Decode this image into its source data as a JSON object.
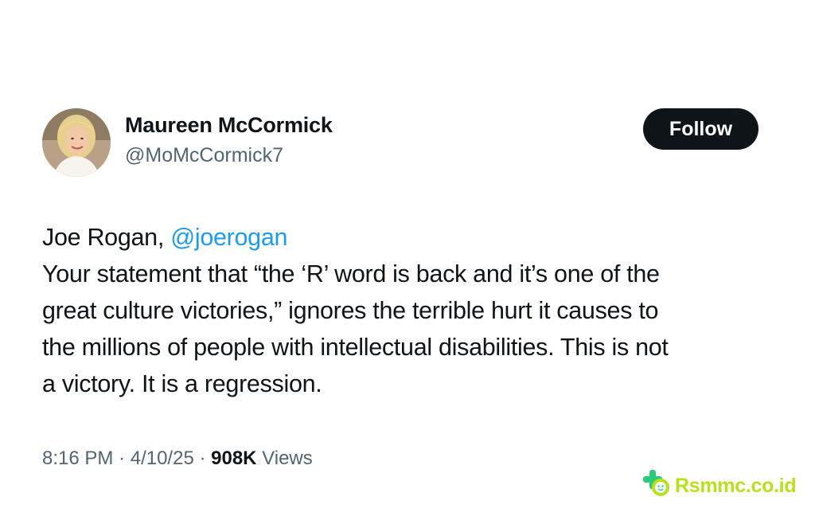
{
  "author": {
    "display_name": "Maureen McCormick",
    "handle": "@MoMcCormick7"
  },
  "follow_button": {
    "label": "Follow"
  },
  "tweet": {
    "line1_prefix": "Joe Rogan, ",
    "mention": "@joerogan",
    "line2": "Your statement that “the ‘R’ word is back and it’s one of the",
    "line3": "great culture victories,” ignores the terrible hurt it causes to",
    "line4": "the millions of people with intellectual disabilities. This is not",
    "line5": "a victory. It is a regression."
  },
  "meta": {
    "time": "8:16 PM",
    "separator": " · ",
    "date": "4/10/25",
    "views_count": "908K",
    "views_label": " Views"
  },
  "watermark": {
    "text": "Rsmmc.co.id",
    "color": "#b6e11c",
    "icon": "plus-face-logo-icon"
  },
  "colors": {
    "text": "#0f1419",
    "secondary": "#536471",
    "link": "#1d9bf0",
    "button_bg": "#0f1419"
  }
}
